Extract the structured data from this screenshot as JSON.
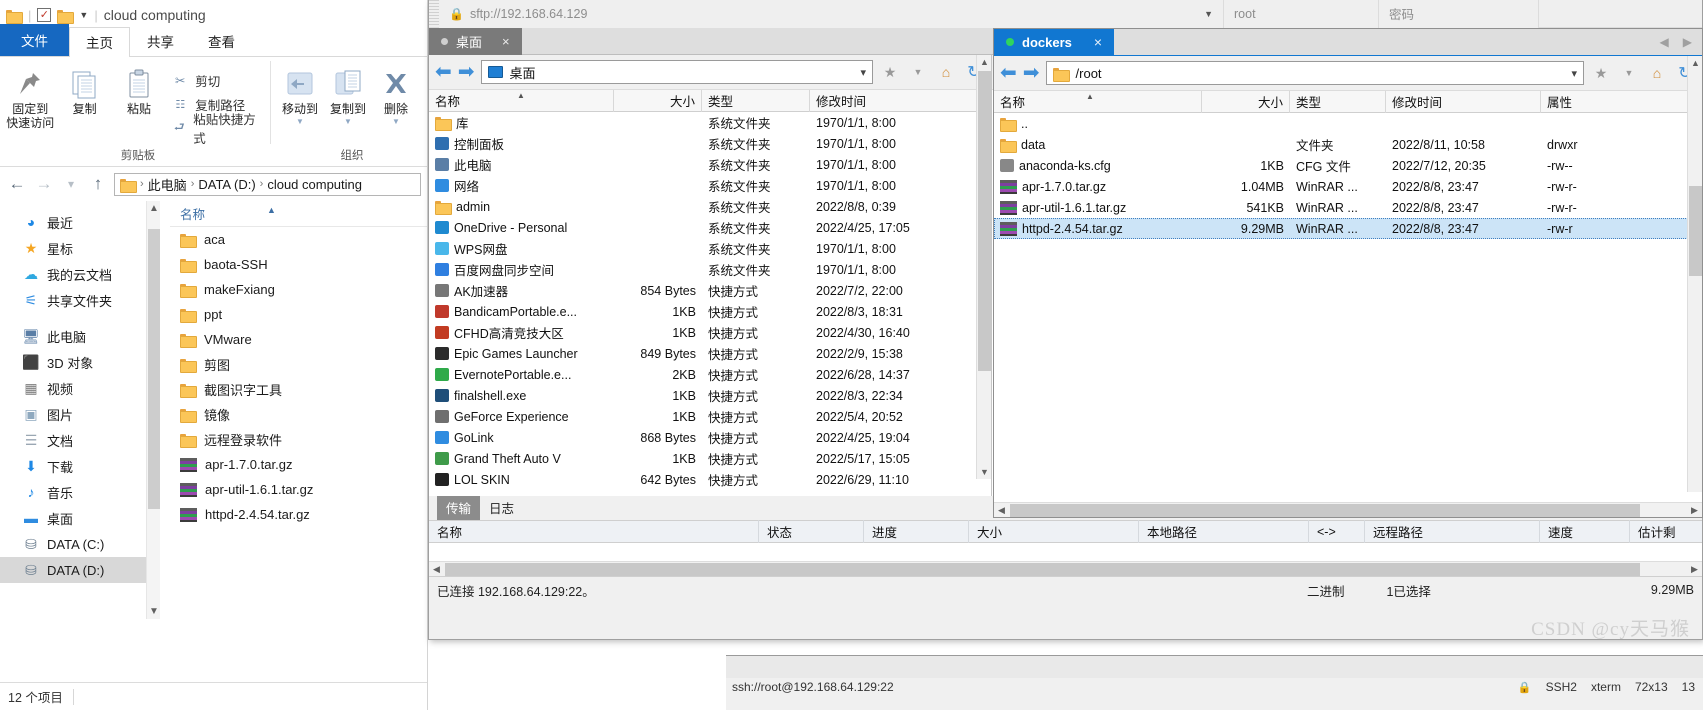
{
  "explorer": {
    "title": "cloud computing",
    "qat": {
      "folder_icon": "folder-icon",
      "check_icon": "checkbox-checked-icon",
      "dropdown_icon": "chevron-down-icon"
    },
    "tabs": [
      {
        "label": "文件",
        "kind": "file"
      },
      {
        "label": "主页",
        "kind": "active"
      },
      {
        "label": "共享",
        "kind": "normal"
      },
      {
        "label": "查看",
        "kind": "normal"
      }
    ],
    "ribbon": {
      "groups": [
        {
          "label": "剪贴板"
        },
        {
          "label": "组织"
        }
      ],
      "pin_label": "固定到\n快速访问",
      "pin_line1": "固定到",
      "pin_line2": "快速访问",
      "copy_label": "复制",
      "paste_label": "粘贴",
      "cut_label": "剪切",
      "copy_path_label": "复制路径",
      "paste_shortcut_label": "粘贴快捷方式",
      "move_to_label": "移动到",
      "copy_to_label": "复制到",
      "delete_label": "删除"
    },
    "address": {
      "crumbs": [
        "此电脑",
        "DATA (D:)",
        "cloud computing"
      ],
      "separator": "›"
    },
    "nav_items": [
      {
        "label": "最近",
        "icon": "recent-clock-icon",
        "glyph": "◕",
        "color": "#1e88e5",
        "selected": false
      },
      {
        "label": "星标",
        "icon": "star-icon",
        "glyph": "★",
        "color": "#f5a623",
        "selected": false
      },
      {
        "label": "我的云文档",
        "icon": "cloud-icon",
        "glyph": "☁",
        "color": "#2fa8e0",
        "selected": false
      },
      {
        "label": "共享文件夹",
        "icon": "share-icon",
        "glyph": "⚟",
        "color": "#2f8ce0",
        "selected": false
      },
      {
        "label": "此电脑",
        "icon": "this-pc-icon",
        "glyph": "🖥",
        "color": "#5a7ea6",
        "selected": false,
        "gap": true
      },
      {
        "label": "3D 对象",
        "icon": "3d-objects-icon",
        "glyph": "⬛",
        "color": "#4ab3e0",
        "selected": false
      },
      {
        "label": "视频",
        "icon": "videos-icon",
        "glyph": "▦",
        "color": "#7a7a7a",
        "selected": false
      },
      {
        "label": "图片",
        "icon": "pictures-icon",
        "glyph": "▣",
        "color": "#8fa9bf",
        "selected": false
      },
      {
        "label": "文档",
        "icon": "documents-icon",
        "glyph": "☰",
        "color": "#9aa7b3",
        "selected": false
      },
      {
        "label": "下载",
        "icon": "downloads-icon",
        "glyph": "⬇",
        "color": "#1e88e5",
        "selected": false
      },
      {
        "label": "音乐",
        "icon": "music-icon",
        "glyph": "♪",
        "color": "#1e88e5",
        "selected": false
      },
      {
        "label": "桌面",
        "icon": "desktop-icon",
        "glyph": "▬",
        "color": "#2f8ce0",
        "selected": false
      },
      {
        "label": "DATA (C:)",
        "icon": "drive-c-icon",
        "glyph": "⛁",
        "color": "#6d7f90",
        "selected": false
      },
      {
        "label": "DATA (D:)",
        "icon": "drive-d-icon",
        "glyph": "⛁",
        "color": "#6d7f90",
        "selected": true
      }
    ],
    "list_header": "名称",
    "items": [
      {
        "name": "aca",
        "type": "folder"
      },
      {
        "name": "baota-SSH",
        "type": "folder"
      },
      {
        "name": "makeFxiang",
        "type": "folder"
      },
      {
        "name": "ppt",
        "type": "folder"
      },
      {
        "name": "VMware",
        "type": "folder"
      },
      {
        "name": "剪图",
        "type": "folder"
      },
      {
        "name": "截图识字工具",
        "type": "folder"
      },
      {
        "name": "镜像",
        "type": "folder"
      },
      {
        "name": "远程登录软件",
        "type": "folder"
      },
      {
        "name": "apr-1.7.0.tar.gz",
        "type": "archive"
      },
      {
        "name": "apr-util-1.6.1.tar.gz",
        "type": "archive"
      },
      {
        "name": "httpd-2.4.54.tar.gz",
        "type": "archive"
      }
    ],
    "status": "12 个项目"
  },
  "filezilla": {
    "quickconnect": {
      "host_value": "sftp://192.168.64.129",
      "user_placeholder": "root",
      "pass_placeholder": "密码",
      "lock_icon": "lock-icon",
      "dropdown_icon": "chevron-down-icon"
    },
    "local_tab": {
      "label": "桌面",
      "close": "×",
      "dot": "status-dot"
    },
    "local": {
      "path_value": "桌面",
      "back_icon": "arrow-left-icon",
      "forward_icon": "arrow-right-icon",
      "star_icon": "star-icon",
      "home_icon": "home-icon",
      "refresh_icon": "refresh-icon",
      "columns": [
        "名称",
        "大小",
        "类型",
        "修改时间"
      ],
      "rows": [
        {
          "name": "库",
          "size": "",
          "type": "系统文件夹",
          "modified": "1970/1/1, 8:00",
          "icon": "library-icon",
          "color": "#e8a33d"
        },
        {
          "name": "控制面板",
          "size": "",
          "type": "系统文件夹",
          "modified": "1970/1/1, 8:00",
          "icon": "control-panel-icon",
          "color": "#2f6fb0"
        },
        {
          "name": "此电脑",
          "size": "",
          "type": "系统文件夹",
          "modified": "1970/1/1, 8:00",
          "icon": "this-pc-icon",
          "color": "#5a7ea6"
        },
        {
          "name": "网络",
          "size": "",
          "type": "系统文件夹",
          "modified": "1970/1/1, 8:00",
          "icon": "network-icon",
          "color": "#2f8ce0"
        },
        {
          "name": "admin",
          "size": "",
          "type": "系统文件夹",
          "modified": "2022/8/8, 0:39",
          "icon": "user-folder-icon",
          "color": "#e8a33d"
        },
        {
          "name": "OneDrive - Personal",
          "size": "",
          "type": "系统文件夹",
          "modified": "2022/4/25, 17:05",
          "icon": "onedrive-icon",
          "color": "#1f8ad0"
        },
        {
          "name": "WPS网盘",
          "size": "",
          "type": "系统文件夹",
          "modified": "1970/1/1, 8:00",
          "icon": "wps-cloud-icon",
          "color": "#49b7ea"
        },
        {
          "name": "百度网盘同步空间",
          "size": "",
          "type": "系统文件夹",
          "modified": "1970/1/1, 8:00",
          "icon": "baidu-netdisk-icon",
          "color": "#2f7fe0"
        },
        {
          "name": "AK加速器",
          "size": "854 Bytes",
          "type": "快捷方式",
          "modified": "2022/7/2, 22:00",
          "icon": "shortcut-icon",
          "color": "#777"
        },
        {
          "name": "BandicamPortable.e...",
          "size": "1KB",
          "type": "快捷方式",
          "modified": "2022/8/3, 18:31",
          "icon": "bandicam-icon",
          "color": "#c0392b"
        },
        {
          "name": "CFHD高清竞技大区",
          "size": "1KB",
          "type": "快捷方式",
          "modified": "2022/4/30, 16:40",
          "icon": "cfhd-icon",
          "color": "#c23b22"
        },
        {
          "name": "Epic Games Launcher",
          "size": "849 Bytes",
          "type": "快捷方式",
          "modified": "2022/2/9, 15:38",
          "icon": "epic-games-icon",
          "color": "#2b2b2b"
        },
        {
          "name": "EvernotePortable.e...",
          "size": "2KB",
          "type": "快捷方式",
          "modified": "2022/6/28, 14:37",
          "icon": "evernote-icon",
          "color": "#2faa4a"
        },
        {
          "name": "finalshell.exe",
          "size": "1KB",
          "type": "快捷方式",
          "modified": "2022/8/3, 22:34",
          "icon": "finalshell-icon",
          "color": "#1f4e79"
        },
        {
          "name": "GeForce Experience",
          "size": "1KB",
          "type": "快捷方式",
          "modified": "2022/5/4, 20:52",
          "icon": "geforce-icon",
          "color": "#6f6f6f"
        },
        {
          "name": "GoLink",
          "size": "868 Bytes",
          "type": "快捷方式",
          "modified": "2022/4/25, 19:04",
          "icon": "golink-icon",
          "color": "#2f8ce0"
        },
        {
          "name": "Grand Theft Auto V",
          "size": "1KB",
          "type": "快捷方式",
          "modified": "2022/5/17, 15:05",
          "icon": "gtav-icon",
          "color": "#3f9b4a"
        },
        {
          "name": "LOL SKIN",
          "size": "642 Bytes",
          "type": "快捷方式",
          "modified": "2022/6/29, 11:10",
          "icon": "lolskin-icon",
          "color": "#222"
        }
      ]
    },
    "remote_tab": {
      "label": "dockers",
      "close": "×",
      "dot": "connected-dot"
    },
    "remote": {
      "path_value": "/root",
      "back_icon": "arrow-left-icon",
      "forward_icon": "arrow-right-icon",
      "star_icon": "star-icon",
      "home_icon": "home-icon",
      "refresh_icon": "refresh-icon",
      "columns": [
        "名称",
        "大小",
        "类型",
        "修改时间",
        "属性"
      ],
      "rows": [
        {
          "name": "..",
          "size": "",
          "type": "",
          "modified": "",
          "attrs": "",
          "icon": "folder-icon",
          "selected": false
        },
        {
          "name": "data",
          "size": "",
          "type": "文件夹",
          "modified": "2022/8/11, 10:58",
          "attrs": "drwxr",
          "icon": "folder-icon",
          "selected": false
        },
        {
          "name": "anaconda-ks.cfg",
          "size": "1KB",
          "type": "CFG 文件",
          "modified": "2022/7/12, 20:35",
          "attrs": "-rw--",
          "icon": "ie-file-icon",
          "selected": false
        },
        {
          "name": "apr-1.7.0.tar.gz",
          "size": "1.04MB",
          "type": "WinRAR ...",
          "modified": "2022/8/8, 23:47",
          "attrs": "-rw-r-",
          "icon": "archive-icon",
          "selected": false
        },
        {
          "name": "apr-util-1.6.1.tar.gz",
          "size": "541KB",
          "type": "WinRAR ...",
          "modified": "2022/8/8, 23:47",
          "attrs": "-rw-r-",
          "icon": "archive-icon",
          "selected": false
        },
        {
          "name": "httpd-2.4.54.tar.gz",
          "size": "9.29MB",
          "type": "WinRAR ...",
          "modified": "2022/8/8, 23:47",
          "attrs": "-rw-r",
          "icon": "archive-icon",
          "selected": true
        }
      ]
    },
    "lower_tabs": [
      {
        "label": "传输",
        "active": true
      },
      {
        "label": "日志",
        "active": false
      }
    ],
    "queue_columns": [
      "名称",
      "状态",
      "进度",
      "大小",
      "本地路径",
      "<->",
      "远程路径",
      "速度",
      "估计剩"
    ],
    "statusbar": {
      "connection": "已连接 192.168.64.129:22。",
      "mode": "二进制",
      "selection": "1已选择",
      "selected_size": "9.29MB"
    }
  },
  "ssh_background": {
    "url": "ssh://root@192.168.64.129:22",
    "protocol": "SSH2",
    "term": "xterm",
    "size": "72x13",
    "rows": "13",
    "lock_icon": "lock-icon"
  },
  "watermark": "CSDN @cy天马猴"
}
